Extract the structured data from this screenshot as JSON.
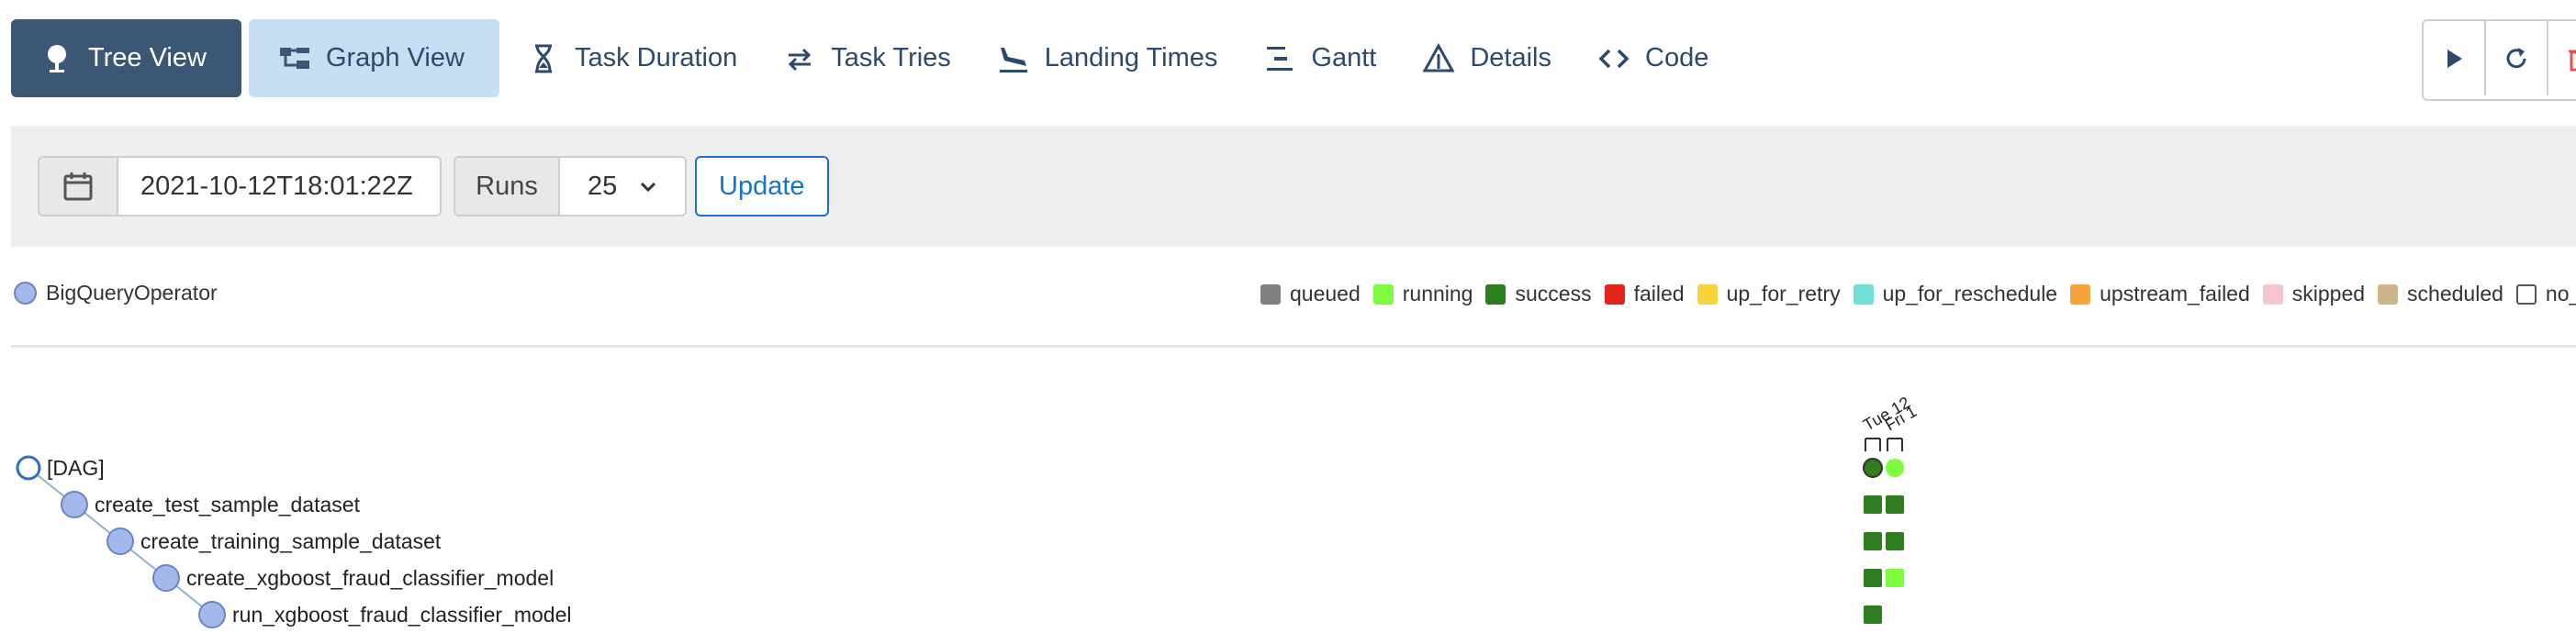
{
  "nav": {
    "tabs": [
      {
        "label": "Tree View",
        "icon": "tree-icon",
        "state": "active"
      },
      {
        "label": "Graph View",
        "icon": "graph-icon",
        "state": "light"
      },
      {
        "label": "Task Duration",
        "icon": "hourglass-icon",
        "state": "plain"
      },
      {
        "label": "Task Tries",
        "icon": "retry-icon",
        "state": "plain"
      },
      {
        "label": "Landing Times",
        "icon": "plane-landing-icon",
        "state": "plain"
      },
      {
        "label": "Gantt",
        "icon": "gantt-icon",
        "state": "plain"
      },
      {
        "label": "Details",
        "icon": "warning-triangle-icon",
        "state": "plain"
      },
      {
        "label": "Code",
        "icon": "code-icon",
        "state": "plain"
      }
    ],
    "right_buttons": [
      "play-icon",
      "refresh-icon",
      "trash-icon"
    ]
  },
  "filter": {
    "date_value": "2021-10-12T18:01:22Z",
    "runs_label": "Runs",
    "runs_value": "25",
    "update_label": "Update"
  },
  "legend": {
    "operator": {
      "label": "BigQueryOperator",
      "color": "#a3b9ec"
    },
    "states": [
      {
        "label": "queued",
        "color": "#808080"
      },
      {
        "label": "running",
        "color": "#7cfc3c"
      },
      {
        "label": "success",
        "color": "#2e7d1e"
      },
      {
        "label": "failed",
        "color": "#e3241b"
      },
      {
        "label": "up_for_retry",
        "color": "#f7d43c"
      },
      {
        "label": "up_for_reschedule",
        "color": "#6fe0d3"
      },
      {
        "label": "upstream_failed",
        "color": "#f4a43a"
      },
      {
        "label": "skipped",
        "color": "#f5c6cf"
      },
      {
        "label": "scheduled",
        "color": "#cdb58a"
      },
      {
        "label": "no_stat",
        "color": "#ffffff"
      }
    ]
  },
  "tree": {
    "nodes": [
      {
        "label": "[DAG]",
        "kind": "dag",
        "runs": [
          "success",
          "running"
        ]
      },
      {
        "label": "create_test_sample_dataset",
        "kind": "task",
        "runs": [
          "success",
          "success"
        ]
      },
      {
        "label": "create_training_sample_dataset",
        "kind": "task",
        "runs": [
          "success",
          "success"
        ]
      },
      {
        "label": "create_xgboost_fraud_classifier_model",
        "kind": "task",
        "runs": [
          "success",
          "running"
        ]
      },
      {
        "label": "run_xgboost_fraud_classifier_model",
        "kind": "task",
        "runs": [
          "success"
        ]
      }
    ],
    "run_dates": [
      "Tue 12",
      "Fri 1"
    ]
  }
}
